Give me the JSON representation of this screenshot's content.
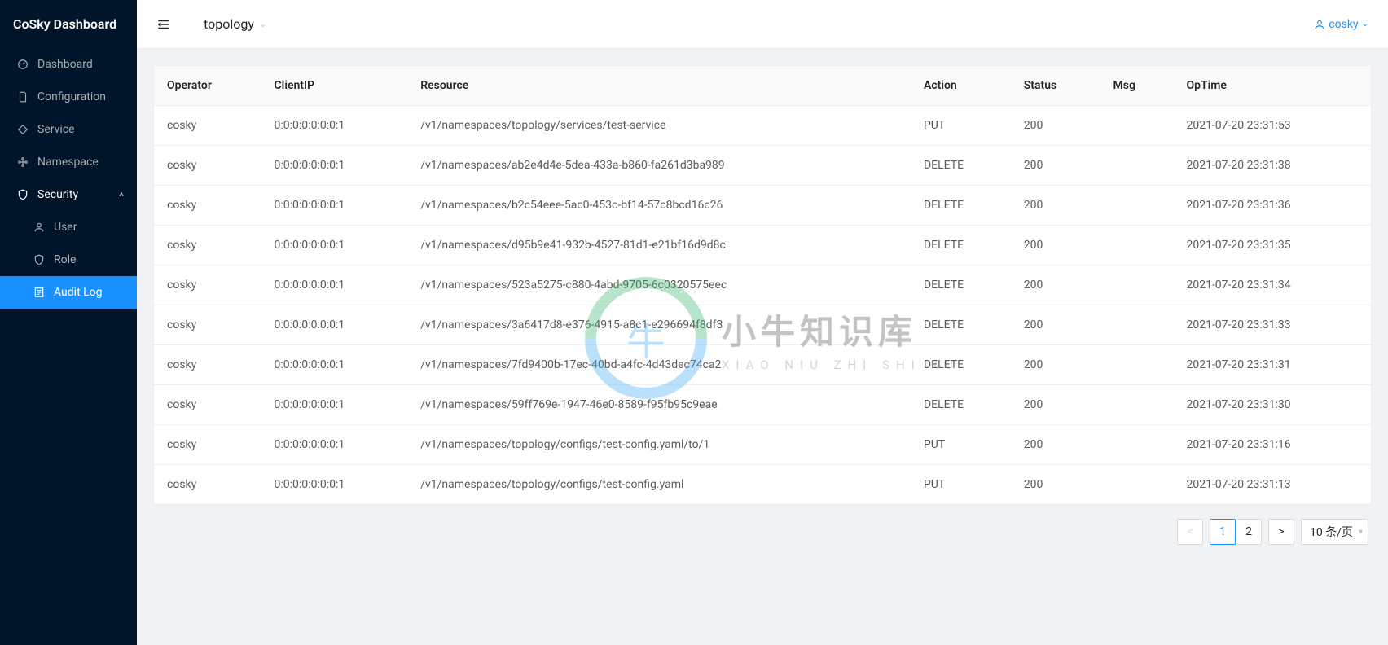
{
  "brand": "CoSky Dashboard",
  "sidebar": {
    "items": [
      {
        "icon": "dashboard",
        "label": "Dashboard"
      },
      {
        "icon": "file",
        "label": "Configuration"
      },
      {
        "icon": "tag",
        "label": "Service"
      },
      {
        "icon": "cluster",
        "label": "Namespace"
      },
      {
        "icon": "shield",
        "label": "Security",
        "expanded": true
      },
      {
        "icon": "user",
        "label": "User",
        "sub": true
      },
      {
        "icon": "shield",
        "label": "Role",
        "sub": true
      },
      {
        "icon": "audit",
        "label": "Audit Log",
        "sub": true,
        "active": true
      }
    ]
  },
  "breadcrumb": "topology",
  "currentUser": "cosky",
  "table": {
    "columns": [
      "Operator",
      "ClientIP",
      "Resource",
      "Action",
      "Status",
      "Msg",
      "OpTime"
    ],
    "rows": [
      {
        "operator": "cosky",
        "clientIp": "0:0:0:0:0:0:0:1",
        "resource": "/v1/namespaces/topology/services/test-service",
        "action": "PUT",
        "status": "200",
        "msg": "",
        "opTime": "2021-07-20 23:31:53"
      },
      {
        "operator": "cosky",
        "clientIp": "0:0:0:0:0:0:0:1",
        "resource": "/v1/namespaces/ab2e4d4e-5dea-433a-b860-fa261d3ba989",
        "action": "DELETE",
        "status": "200",
        "msg": "",
        "opTime": "2021-07-20 23:31:38"
      },
      {
        "operator": "cosky",
        "clientIp": "0:0:0:0:0:0:0:1",
        "resource": "/v1/namespaces/b2c54eee-5ac0-453c-bf14-57c8bcd16c26",
        "action": "DELETE",
        "status": "200",
        "msg": "",
        "opTime": "2021-07-20 23:31:36"
      },
      {
        "operator": "cosky",
        "clientIp": "0:0:0:0:0:0:0:1",
        "resource": "/v1/namespaces/d95b9e41-932b-4527-81d1-e21bf16d9d8c",
        "action": "DELETE",
        "status": "200",
        "msg": "",
        "opTime": "2021-07-20 23:31:35"
      },
      {
        "operator": "cosky",
        "clientIp": "0:0:0:0:0:0:0:1",
        "resource": "/v1/namespaces/523a5275-c880-4abd-9705-6c0320575eec",
        "action": "DELETE",
        "status": "200",
        "msg": "",
        "opTime": "2021-07-20 23:31:34"
      },
      {
        "operator": "cosky",
        "clientIp": "0:0:0:0:0:0:0:1",
        "resource": "/v1/namespaces/3a6417d8-e376-4915-a8c1-e296694f8df3",
        "action": "DELETE",
        "status": "200",
        "msg": "",
        "opTime": "2021-07-20 23:31:33"
      },
      {
        "operator": "cosky",
        "clientIp": "0:0:0:0:0:0:0:1",
        "resource": "/v1/namespaces/7fd9400b-17ec-40bd-a4fc-4d43dec74ca2",
        "action": "DELETE",
        "status": "200",
        "msg": "",
        "opTime": "2021-07-20 23:31:31"
      },
      {
        "operator": "cosky",
        "clientIp": "0:0:0:0:0:0:0:1",
        "resource": "/v1/namespaces/59ff769e-1947-46e0-8589-f95fb95c9eae",
        "action": "DELETE",
        "status": "200",
        "msg": "",
        "opTime": "2021-07-20 23:31:30"
      },
      {
        "operator": "cosky",
        "clientIp": "0:0:0:0:0:0:0:1",
        "resource": "/v1/namespaces/topology/configs/test-config.yaml/to/1",
        "action": "PUT",
        "status": "200",
        "msg": "",
        "opTime": "2021-07-20 23:31:16"
      },
      {
        "operator": "cosky",
        "clientIp": "0:0:0:0:0:0:0:1",
        "resource": "/v1/namespaces/topology/configs/test-config.yaml",
        "action": "PUT",
        "status": "200",
        "msg": "",
        "opTime": "2021-07-20 23:31:13"
      }
    ]
  },
  "pagination": {
    "pages": [
      "1",
      "2"
    ],
    "current": "1",
    "sizeLabel": "10 条/页"
  },
  "watermark": {
    "cn": "小牛知识库",
    "en": "XIAO NIU ZHI SHI KU"
  }
}
